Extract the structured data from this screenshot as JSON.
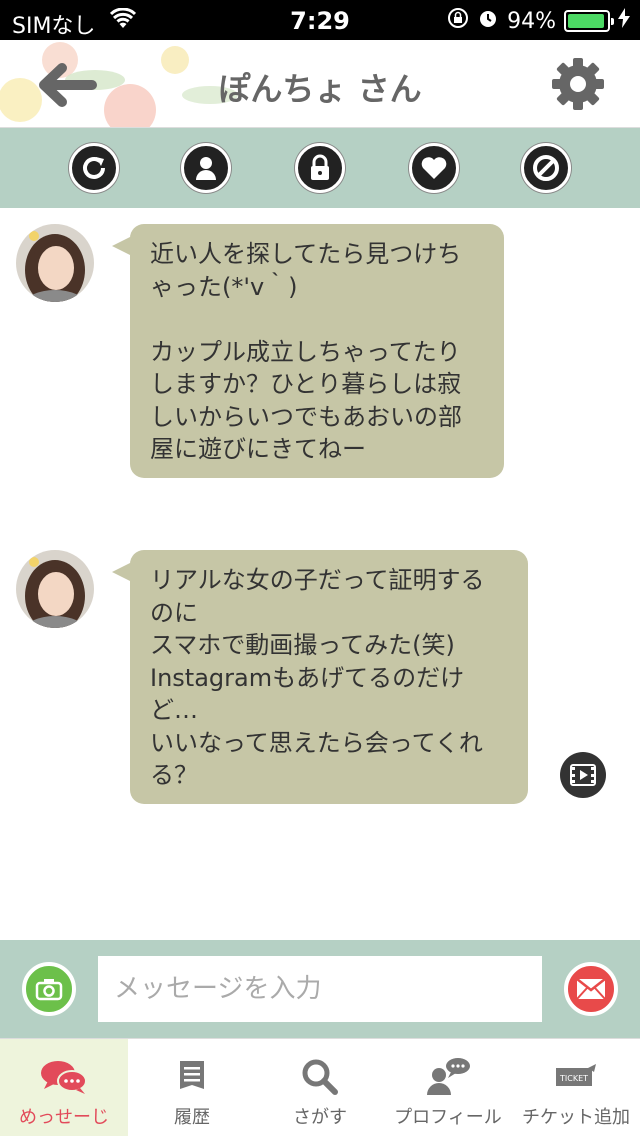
{
  "status_bar": {
    "carrier": "SIMなし",
    "time": "7:29",
    "battery": "94%",
    "battery_level": 0.94
  },
  "header": {
    "title": "ぽんちょ さん"
  },
  "actions": [
    {
      "name": "refresh-icon"
    },
    {
      "name": "profile-icon"
    },
    {
      "name": "lock-icon"
    },
    {
      "name": "heart-icon"
    },
    {
      "name": "block-icon"
    }
  ],
  "messages": [
    {
      "text": "近い人を探してたら見つけちゃった(*'v｀)\n\nカップル成立しちゃってたりしますか？ひとり暮らしは寂しいからいつでもあおいの部屋に遊びにきてねー"
    },
    {
      "text": "リアルな女の子だって証明するのに\nスマホで動画撮ってみた(笑)\nInstagramもあげてるのだけど…\nいいなって思えたら会ってくれる？"
    }
  ],
  "composer": {
    "placeholder": "メッセージを入力"
  },
  "tabs": [
    {
      "label": "めっせーじ",
      "icon": "chat-icon",
      "active": true
    },
    {
      "label": "履歴",
      "icon": "history-icon"
    },
    {
      "label": "さがす",
      "icon": "search-icon"
    },
    {
      "label": "プロフィール",
      "icon": "profile-icon"
    },
    {
      "label": "チケット追加",
      "icon": "ticket-icon"
    }
  ],
  "colors": {
    "accent_green": "#b5d0c4",
    "bubble": "#c6c6a6",
    "tab_active": "#e24a5a"
  }
}
